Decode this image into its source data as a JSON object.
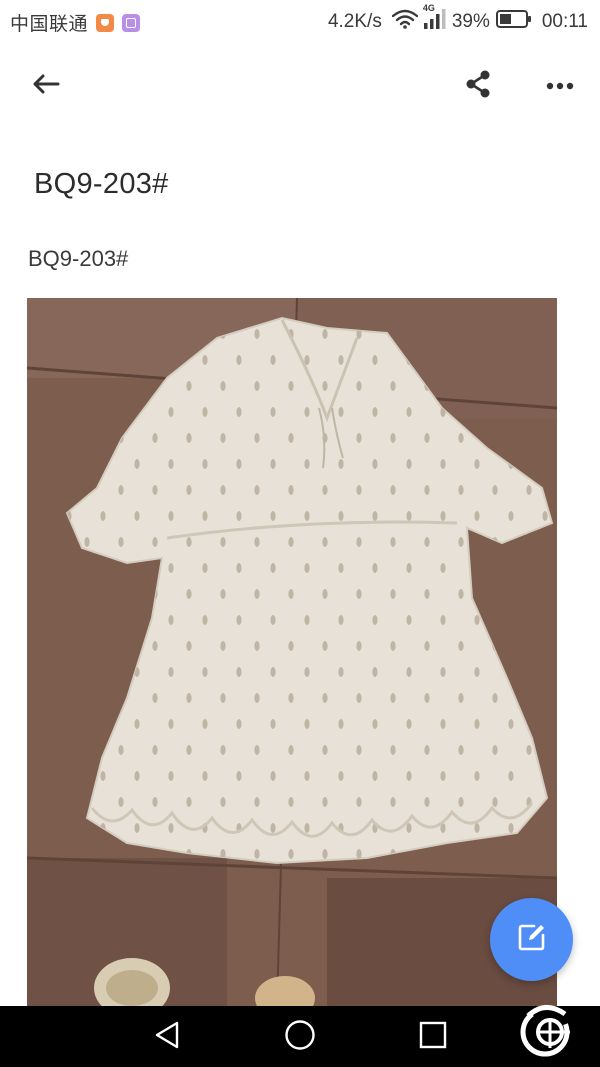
{
  "status_bar": {
    "carrier": "中国联通",
    "net_speed": "4.2K/s",
    "network_type": "4G",
    "battery": "39%",
    "time": "00:11",
    "app_icons": [
      "orange-app-icon",
      "purple-gallery-icon"
    ]
  },
  "app_bar": {
    "back_icon": "arrow-back-icon",
    "share_icon": "share-icon",
    "more_icon": "more-horizontal-icon"
  },
  "content": {
    "title": "BQ9-203#",
    "body": "BQ9-203#",
    "photo_subject": "white-eyelet-dress-photo"
  },
  "fab": {
    "icon": "edit-icon",
    "color": "#4f8ef7"
  },
  "nav_bar": {
    "back_icon": "nav-back-triangle-icon",
    "home_icon": "nav-home-circle-icon",
    "recent_icon": "nav-recent-square-icon"
  },
  "colors": {
    "accent": "#4f8ef7",
    "text": "#2c2c2c",
    "nav_background": "#000000"
  }
}
